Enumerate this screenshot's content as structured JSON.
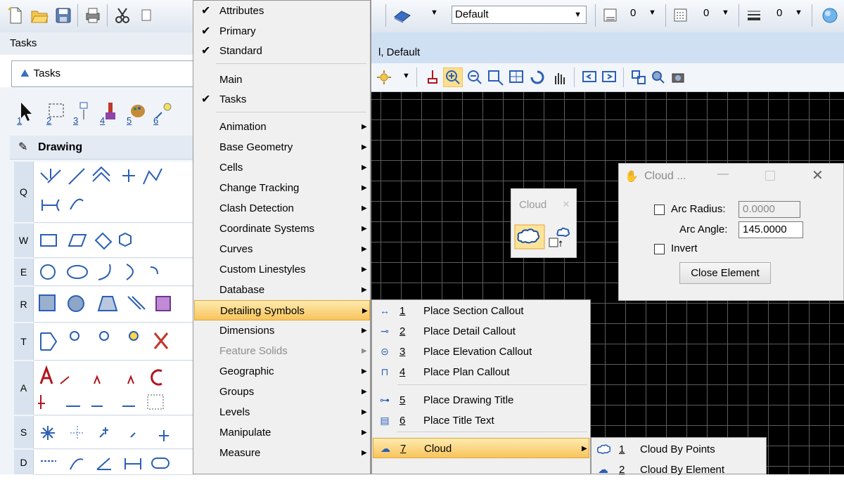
{
  "toolbar": {
    "level_combo": "Default",
    "weight_value_1": "0",
    "weight_value_2": "0",
    "weight_value_3": "0"
  },
  "tasks_panel": {
    "title": "Tasks",
    "tab_label": "Tasks",
    "section_header": "Drawing",
    "row_numbers": [
      "1",
      "2",
      "3",
      "4",
      "5",
      "6"
    ],
    "row_letters": [
      "Q",
      "W",
      "E",
      "R",
      "T",
      "A",
      "S",
      "D"
    ]
  },
  "view": {
    "title": "l, Default"
  },
  "main_menu": {
    "items": [
      {
        "label": "Attributes",
        "checked": true
      },
      {
        "label": "Primary",
        "checked": true
      },
      {
        "label": "Standard",
        "checked": true
      },
      {
        "label": "Main",
        "checked": false
      },
      {
        "label": "Tasks",
        "checked": true
      },
      {
        "label": "Animation",
        "submenu": true
      },
      {
        "label": "Base Geometry",
        "submenu": true
      },
      {
        "label": "Cells",
        "submenu": true
      },
      {
        "label": "Change Tracking",
        "submenu": true
      },
      {
        "label": "Clash Detection",
        "submenu": true
      },
      {
        "label": "Coordinate Systems",
        "submenu": true
      },
      {
        "label": "Curves",
        "submenu": true
      },
      {
        "label": "Custom Linestyles",
        "submenu": true
      },
      {
        "label": "Database",
        "submenu": true
      },
      {
        "label": "Detailing Symbols",
        "submenu": true,
        "highlighted": true
      },
      {
        "label": "Dimensions",
        "submenu": true
      },
      {
        "label": "Feature Solids",
        "submenu": true,
        "disabled": true
      },
      {
        "label": "Geographic",
        "submenu": true
      },
      {
        "label": "Groups",
        "submenu": true
      },
      {
        "label": "Levels",
        "submenu": true
      },
      {
        "label": "Manipulate",
        "submenu": true
      },
      {
        "label": "Measure",
        "submenu": true
      }
    ]
  },
  "detailing_submenu": {
    "items": [
      {
        "num": "1",
        "label": "Place Section Callout"
      },
      {
        "num": "2",
        "label": "Place Detail Callout"
      },
      {
        "num": "3",
        "label": "Place Elevation Callout"
      },
      {
        "num": "4",
        "label": "Place Plan Callout"
      },
      {
        "num": "5",
        "label": "Place Drawing Title"
      },
      {
        "num": "6",
        "label": "Place Title Text"
      },
      {
        "num": "7",
        "label": "Cloud"
      }
    ]
  },
  "cloud_submenu": {
    "items": [
      {
        "num": "1",
        "label": "Cloud By Points"
      },
      {
        "num": "2",
        "label": "Cloud By Element"
      }
    ]
  },
  "cloud_palette": {
    "title": "Cloud"
  },
  "cloud_dialog": {
    "title": "Cloud ...",
    "arc_radius_label": "Arc Radius:",
    "arc_radius_value": "0.0000",
    "arc_angle_label": "Arc Angle:",
    "arc_angle_value": "145.0000",
    "invert_label": "Invert",
    "close_element_label": "Close Element"
  },
  "colors": {
    "menu_highlight": "#f8c45c",
    "view_background": "#000000",
    "title_bar": "#cfe0f2"
  }
}
